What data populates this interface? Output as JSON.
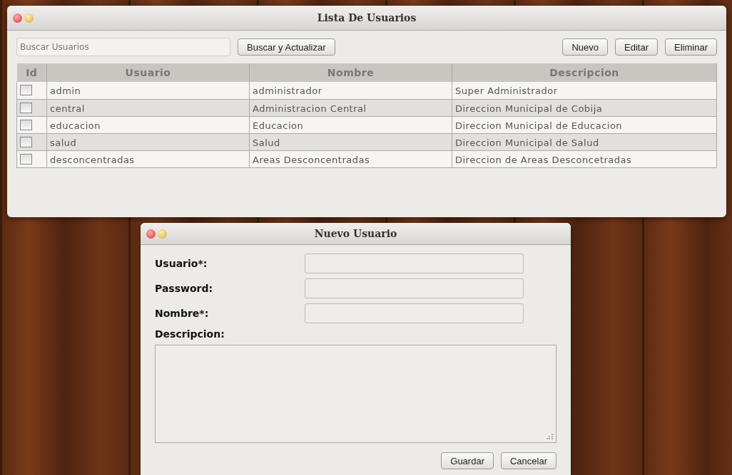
{
  "main_window": {
    "title": "Lista De Usuarios",
    "search": {
      "placeholder": "Buscar Usuarios"
    },
    "search_button": "Buscar y Actualizar",
    "buttons": [
      "Nuevo",
      "Editar",
      "Eliminar"
    ],
    "table": {
      "columns": [
        "Id",
        "Usuario",
        "Nombre",
        "Descripcion"
      ],
      "rows": [
        {
          "checked": false,
          "usuario": "admin",
          "nombre": "administrador",
          "descripcion": "Super Administrador"
        },
        {
          "checked": false,
          "usuario": "central",
          "nombre": "Administracion Central",
          "descripcion": "Direccion Municipal de Cobija"
        },
        {
          "checked": false,
          "usuario": "educacion",
          "nombre": "Educacion",
          "descripcion": "Direccion Municipal de Educacion"
        },
        {
          "checked": false,
          "usuario": "salud",
          "nombre": "Salud",
          "descripcion": "Direccion Municipal de Salud"
        },
        {
          "checked": false,
          "usuario": "desconcentradas",
          "nombre": "Areas Desconcentradas",
          "descripcion": "Direccion de Areas Desconcetradas"
        }
      ]
    }
  },
  "dialog": {
    "title": "Nuevo Usuario",
    "fields": [
      {
        "label": "Usuario*:"
      },
      {
        "label": "Password:"
      },
      {
        "label": "Nombre*:"
      }
    ],
    "description_label": "Descripcion:",
    "buttons": [
      "Guardar",
      "Cancelar"
    ]
  }
}
